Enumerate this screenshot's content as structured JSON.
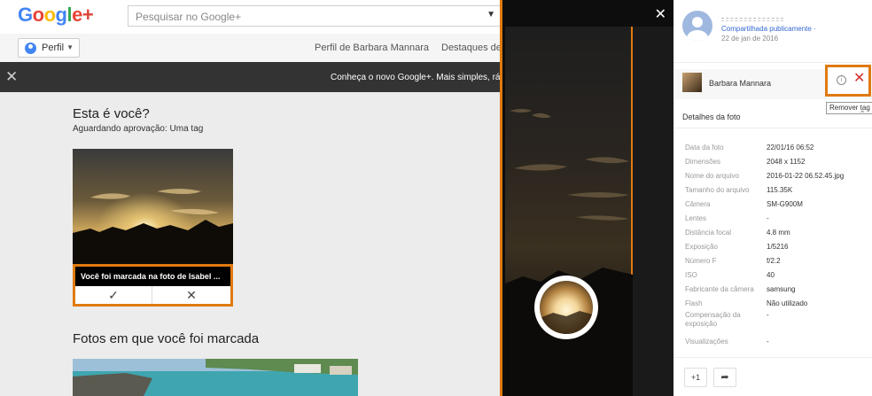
{
  "header": {
    "logo_text": "Google+",
    "search_placeholder": "Pesquisar no Google+"
  },
  "subnav": {
    "profile_button": "Perfil",
    "links": [
      "Perfil de Barbara Mannara",
      "Destaques de"
    ]
  },
  "banner": {
    "text": "Conheça o novo Google+.   Mais simples, ráp"
  },
  "tag_review": {
    "title": "Esta é você?",
    "subtitle": "Aguardando aprovação: Uma tag",
    "caption": "Você foi marcada na foto de Isabel ...",
    "accept_glyph": "✓",
    "reject_glyph": "✕"
  },
  "tagged_section": {
    "title": "Fotos em que você foi marcada"
  },
  "viewer": {
    "close_glyph": "✕"
  },
  "post": {
    "shared_label": "Compartilhada publicamente ·",
    "date": "22 de jan de 2016"
  },
  "person_tag": {
    "name": "Barbara Mannara",
    "info_glyph": "i",
    "remove_glyph": "✕",
    "tooltip": "Remover tag"
  },
  "photo_details": {
    "heading": "Detalhes da foto",
    "rows": [
      {
        "label": "Data da foto",
        "value": "22/01/16 06:52"
      },
      {
        "label": "Dimensões",
        "value": "2048 x 1152"
      },
      {
        "label": "Nome do arquivo",
        "value": "2016-01-22 06.52.45.jpg"
      },
      {
        "label": "Tamanho do arquivo",
        "value": "115.35K"
      },
      {
        "label": "Câmera",
        "value": "SM-G900M"
      },
      {
        "label": "Lentes",
        "value": "-"
      },
      {
        "label": "Distância focal",
        "value": "4.8 mm"
      },
      {
        "label": "Exposição",
        "value": "1/5216"
      },
      {
        "label": "Número F",
        "value": "f/2.2"
      },
      {
        "label": "ISO",
        "value": "40"
      },
      {
        "label": "Fabricante da câmera",
        "value": "samsung"
      },
      {
        "label": "Flash",
        "value": "Não utilizado"
      },
      {
        "label": "Compensação da exposição",
        "value": "-"
      },
      {
        "label": "Visualizações",
        "value": "-"
      }
    ]
  },
  "actions": {
    "plus_one": "+1",
    "share_glyph": "➦"
  },
  "colors": {
    "highlight": "#e07a10",
    "remove": "#d32f2f",
    "link": "#3367d6"
  }
}
